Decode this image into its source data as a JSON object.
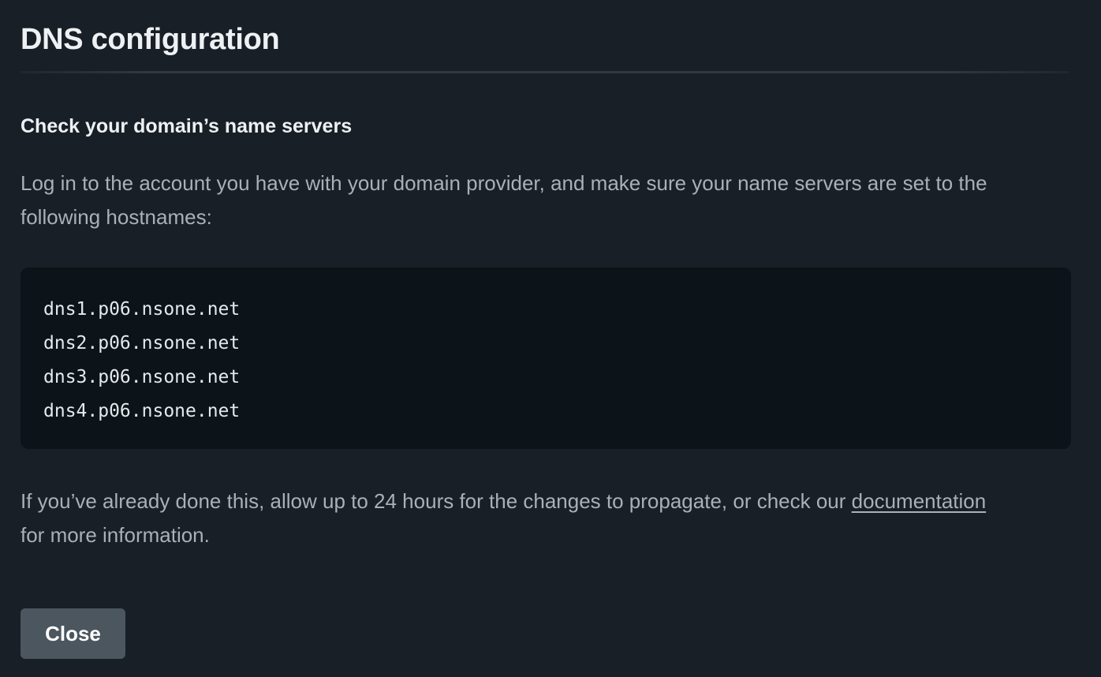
{
  "dialog": {
    "title": "DNS configuration",
    "section_heading": "Check your domain’s name servers",
    "instructions": "Log in to the account you have with your domain provider, and make sure your name servers are set to the following hostnames:",
    "name_servers": [
      "dns1.p06.nsone.net",
      "dns2.p06.nsone.net",
      "dns3.p06.nsone.net",
      "dns4.p06.nsone.net"
    ],
    "footer": {
      "before_link": "If you’ve already done this, allow up to 24 hours for the changes to propagate, or check our ",
      "link_text": "documentation",
      "after_link": " for more information."
    },
    "close_label": "Close"
  },
  "colors": {
    "background": "#181f26",
    "code_background": "#0c1419",
    "button_background": "#4b565f",
    "muted_text": "#a8b0b8",
    "heading_text": "#eef1f3"
  }
}
